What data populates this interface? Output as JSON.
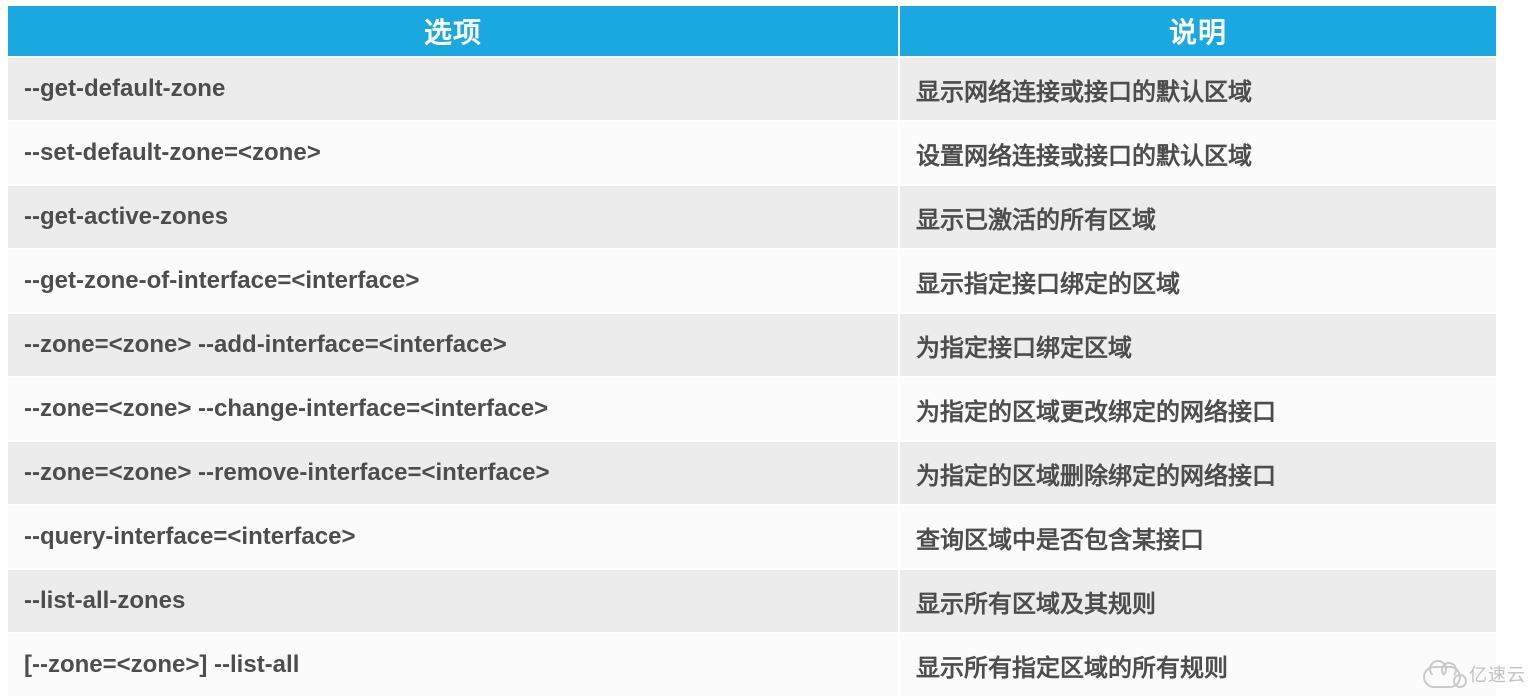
{
  "table": {
    "headers": {
      "option": "选项",
      "description": "说明"
    },
    "rows": [
      {
        "option": "--get-default-zone",
        "description": "显示网络连接或接口的默认区域"
      },
      {
        "option": "--set-default-zone=<zone>",
        "description": "设置网络连接或接口的默认区域"
      },
      {
        "option": "--get-active-zones",
        "description": "显示已激活的所有区域"
      },
      {
        "option": "--get-zone-of-interface=<interface>",
        "description": "显示指定接口绑定的区域"
      },
      {
        "option": "--zone=<zone> --add-interface=<interface>",
        "description": "为指定接口绑定区域"
      },
      {
        "option": "--zone=<zone> --change-interface=<interface>",
        "description": "为指定的区域更改绑定的网络接口"
      },
      {
        "option": "--zone=<zone> --remove-interface=<interface>",
        "description": "为指定的区域删除绑定的网络接口"
      },
      {
        "option": "--query-interface=<interface>",
        "description": "查询区域中是否包含某接口"
      },
      {
        "option": "--list-all-zones",
        "description": "显示所有区域及其规则"
      },
      {
        "option": "[--zone=<zone>] --list-all",
        "description": "显示所有指定区域的所有规则"
      }
    ]
  },
  "watermark": {
    "text": "亿速云"
  }
}
